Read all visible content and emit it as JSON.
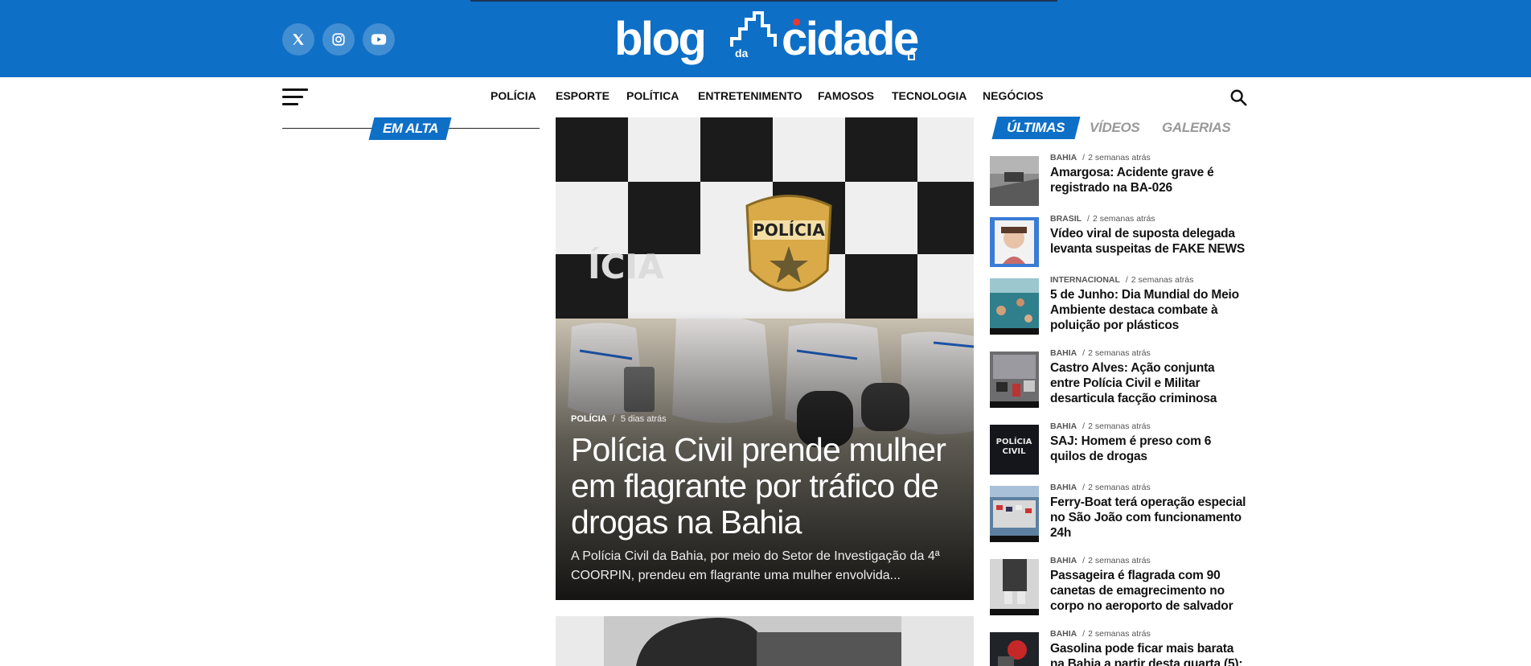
{
  "header": {
    "logo": {
      "blog": "blog",
      "da": "da",
      "cidade": "cidade"
    },
    "social": [
      "x-icon",
      "instagram-icon",
      "youtube-icon"
    ],
    "brand_color": "#0e6fc6"
  },
  "nav": {
    "items": [
      "POLÍCIA",
      "ESPORTE",
      "POLÍTICA",
      "ENTRETENIMENTO",
      "FAMOSOS",
      "TECNOLOGIA",
      "NEGÓCIOS"
    ]
  },
  "left": {
    "section_label": "EM ALTA"
  },
  "featured": {
    "category": "POLÍCIA",
    "separator": "/",
    "time": "5 dias atrás",
    "title": "Polícia Civil prende mulher em flagrante por tráfico de drogas na Bahia",
    "excerpt": "A Polícia Civil da Bahia, por meio do Setor de Investigação da 4ª COORPIN, prendeu em flagrante uma mulher envolvida..."
  },
  "sidebar": {
    "tabs": [
      "ÚLTIMAS",
      "VÍDEOS",
      "GALERIAS"
    ],
    "items": [
      {
        "category": "BAHIA",
        "time": "2 semanas atrás",
        "title": "Amargosa: Acidente grave é registrado na BA-026"
      },
      {
        "category": "BRASIL",
        "time": "2 semanas atrás",
        "title": "Vídeo viral de suposta delegada levanta suspeitas de FAKE NEWS"
      },
      {
        "category": "INTERNACIONAL",
        "time": "2 semanas atrás",
        "title": "5 de Junho: Dia Mundial do Meio Ambiente destaca combate à poluição por plásticos"
      },
      {
        "category": "BAHIA",
        "time": "2 semanas atrás",
        "title": "Castro Alves: Ação conjunta entre Polícia Civil e Militar desarticula facção criminosa"
      },
      {
        "category": "BAHIA",
        "time": "2 semanas atrás",
        "title": "SAJ: Homem é preso com 6 quilos de drogas"
      },
      {
        "category": "BAHIA",
        "time": "2 semanas atrás",
        "title": "Ferry-Boat terá operação especial no São João com funcionamento 24h"
      },
      {
        "category": "BAHIA",
        "time": "2 semanas atrás",
        "title": "Passageira é flagrada com 90 canetas de emagrecimento no corpo no aeroporto de salvador"
      },
      {
        "category": "BAHIA",
        "time": "2 semanas atrás",
        "title": "Gasolina pode ficar mais barata na Bahia a partir desta quarta (5):"
      }
    ]
  }
}
